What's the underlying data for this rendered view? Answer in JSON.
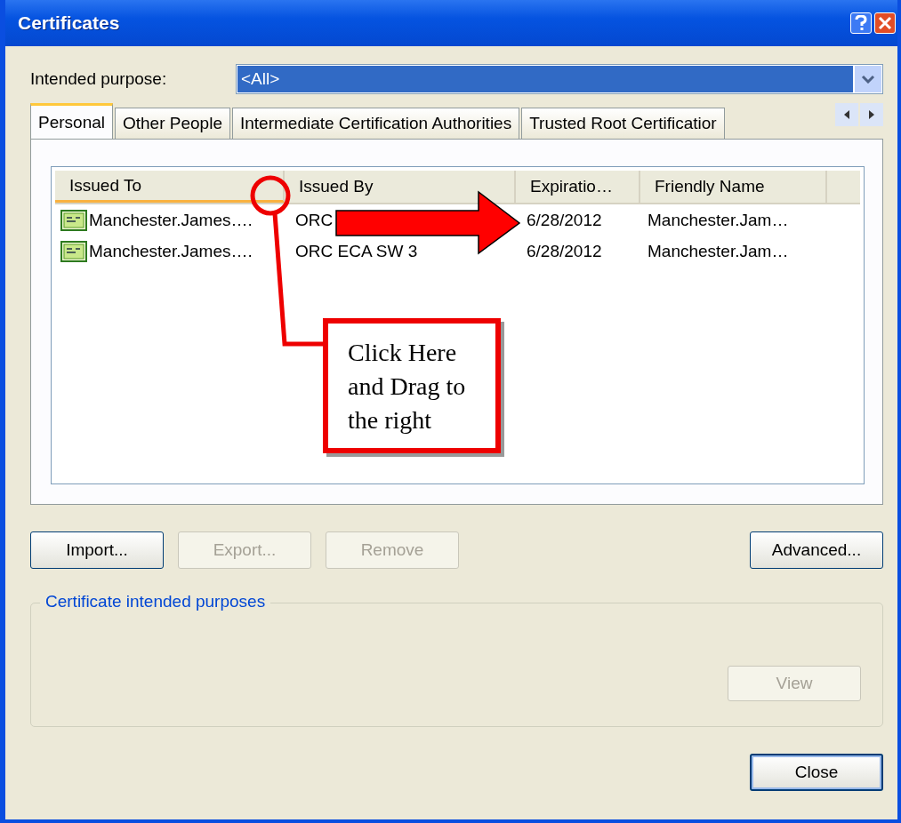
{
  "window": {
    "title": "Certificates"
  },
  "intended_purpose": {
    "label": "Intended purpose:",
    "value": "<All>"
  },
  "tabs": [
    {
      "label": "Personal",
      "selected": true
    },
    {
      "label": "Other People",
      "selected": false
    },
    {
      "label": "Intermediate Certification Authorities",
      "selected": false
    },
    {
      "label": "Trusted Root Certificatior",
      "selected": false
    }
  ],
  "table": {
    "columns": [
      "Issued To",
      "Issued By",
      "Expiratio…",
      "Friendly Name"
    ],
    "rows": [
      [
        "Manchester.James….",
        "ORC",
        "6/28/2012",
        "Manchester.Jam…"
      ],
      [
        "Manchester.James….",
        "ORC ECA SW 3",
        "6/28/2012",
        "Manchester.Jam…"
      ]
    ]
  },
  "buttons": [
    {
      "label": "Import...",
      "disabled": false
    },
    {
      "label": "Export...",
      "disabled": true
    },
    {
      "label": "Remove",
      "disabled": true
    },
    {
      "label": "Advanced...",
      "disabled": false
    }
  ],
  "purposes_group": {
    "title": "Certificate intended purposes",
    "view_button": {
      "label": "View",
      "disabled": true
    }
  },
  "close_button": {
    "label": "Close",
    "disabled": false
  },
  "annotation": {
    "text": "Click Here and Drag to the right"
  }
}
